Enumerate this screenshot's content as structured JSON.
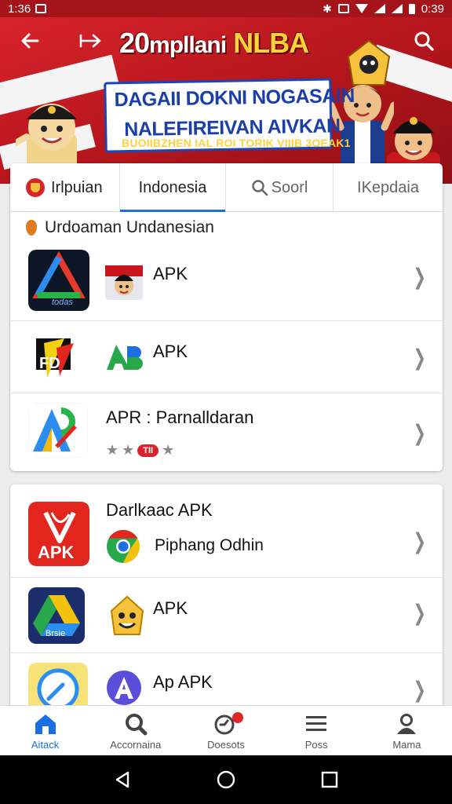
{
  "status_bar": {
    "time": "1:36",
    "battery": "0:39"
  },
  "banner": {
    "headline_num": "20",
    "headline_word": "mpllani",
    "headline_brand": "NLBA",
    "promo_line1": "DAGAII DOKNI NOGASAIN",
    "promo_line2": "NALEFIREIVAN AIVKAN",
    "promo_sub": "BUOIIBZHEN IAL ROI TORIK VIIIB 3OEAK1"
  },
  "tabs": [
    {
      "label": "Irlpuian"
    },
    {
      "label": "Indonesia"
    },
    {
      "label": "Soorl"
    },
    {
      "label": "IKepdaia"
    }
  ],
  "section": {
    "title": "Urdoaman Undanesian"
  },
  "list1": [
    {
      "title": "APK"
    },
    {
      "title": "APK"
    },
    {
      "title": "APR : Parnalldaran",
      "badge": "TII"
    }
  ],
  "list2": [
    {
      "title": "Darlkaac APK",
      "subtitle": "Piphang Odhin"
    },
    {
      "title": "APK"
    },
    {
      "title": "Ap APK"
    }
  ],
  "app_icon_text": {
    "a1": "todas",
    "a2": "APK",
    "a3": "Brsie"
  },
  "bottom_nav": [
    {
      "label": "Aitack",
      "icon": "home-icon"
    },
    {
      "label": "Accornaina",
      "icon": "search-icon"
    },
    {
      "label": "Doesots",
      "icon": "updates-icon"
    },
    {
      "label": "Poss",
      "icon": "menu-icon"
    },
    {
      "label": "Mama",
      "icon": "profile-icon"
    }
  ],
  "colors": {
    "brand_red": "#d8232b",
    "accent_blue": "#1c6ee3",
    "headline_yellow": "#ffd23a"
  }
}
